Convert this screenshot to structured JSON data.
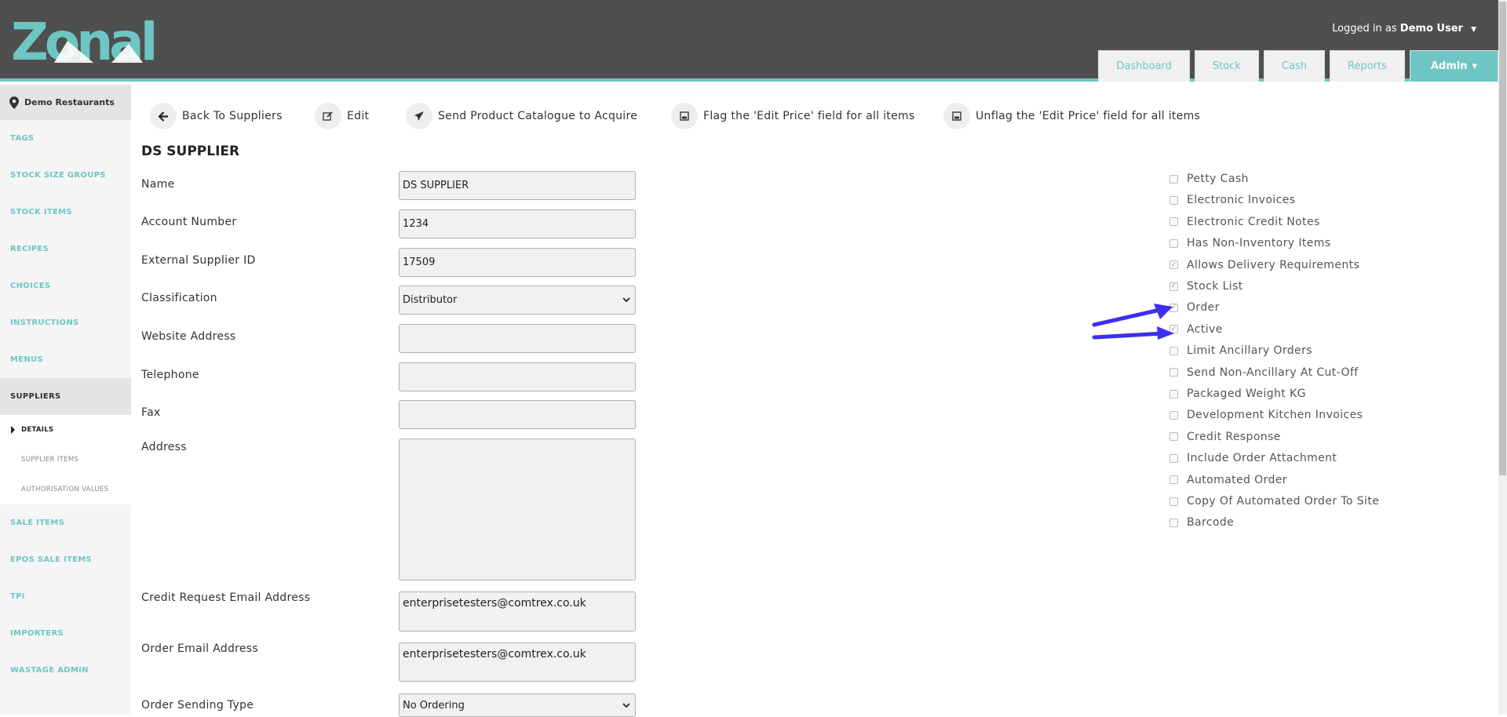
{
  "header": {
    "logo_text": "Zonal",
    "logged_in_prefix": "Logged in as",
    "user": "Demo User",
    "tabs": [
      "Dashboard",
      "Stock",
      "Cash",
      "Reports"
    ],
    "admin_tab": "Admin"
  },
  "sidebar": {
    "site": "Demo Restaurants",
    "items": [
      "TAGS",
      "STOCK SIZE GROUPS",
      "STOCK ITEMS",
      "RECIPES",
      "CHOICES",
      "INSTRUCTIONS",
      "MENUS",
      "SUPPLIERS"
    ],
    "sub_current": "DETAILS",
    "sub_items": [
      "SUPPLIER ITEMS",
      "AUTHORISATION VALUES"
    ],
    "items_after": [
      "SALE ITEMS",
      "EPOS SALE ITEMS",
      "TPI",
      "IMPORTERS",
      "WASTAGE ADMIN"
    ]
  },
  "actions": {
    "back": "Back To Suppliers",
    "edit": "Edit",
    "send": "Send Product Catalogue to Acquire",
    "flag": "Flag the 'Edit Price' field for all items",
    "unflag": "Unflag the 'Edit Price' field for all items"
  },
  "form": {
    "title": "DS SUPPLIER",
    "name_label": "Name",
    "name_value": "DS SUPPLIER",
    "account_label": "Account Number",
    "account_value": "1234",
    "external_label": "External Supplier ID",
    "external_value": "17509",
    "classification_label": "Classification",
    "classification_value": "Distributor",
    "website_label": "Website Address",
    "website_value": "",
    "telephone_label": "Telephone",
    "telephone_value": "",
    "fax_label": "Fax",
    "fax_value": "",
    "address_label": "Address",
    "address_value": "",
    "credit_email_label": "Credit Request Email Address",
    "credit_email_value": "enterprisetesters@comtrex.co.uk",
    "order_email_label": "Order Email Address",
    "order_email_value": "enterprisetesters@comtrex.co.uk",
    "sending_type_label": "Order Sending Type",
    "sending_type_value": "No Ordering"
  },
  "checkboxes": [
    {
      "label": "Petty Cash",
      "checked": false
    },
    {
      "label": "Electronic Invoices",
      "checked": false
    },
    {
      "label": "Electronic Credit Notes",
      "checked": false
    },
    {
      "label": "Has Non-Inventory Items",
      "checked": false
    },
    {
      "label": "Allows Delivery Requirements",
      "checked": true
    },
    {
      "label": "Stock List",
      "checked": true
    },
    {
      "label": "Order",
      "checked": true
    },
    {
      "label": "Active",
      "checked": true
    },
    {
      "label": "Limit Ancillary Orders",
      "checked": false
    },
    {
      "label": "Send Non-Ancillary At Cut-Off",
      "checked": false
    },
    {
      "label": "Packaged Weight KG",
      "checked": false
    },
    {
      "label": "Development Kitchen Invoices",
      "checked": false
    },
    {
      "label": "Credit Response",
      "checked": false
    },
    {
      "label": "Include Order Attachment",
      "checked": false
    },
    {
      "label": "Automated Order",
      "checked": false
    },
    {
      "label": "Copy Of Automated Order To Site",
      "checked": false
    },
    {
      "label": "Barcode",
      "checked": false
    }
  ],
  "colors": {
    "accent": "#6ec6c4",
    "header_bg": "#4f4f4f",
    "arrow": "#3b2ff0"
  }
}
